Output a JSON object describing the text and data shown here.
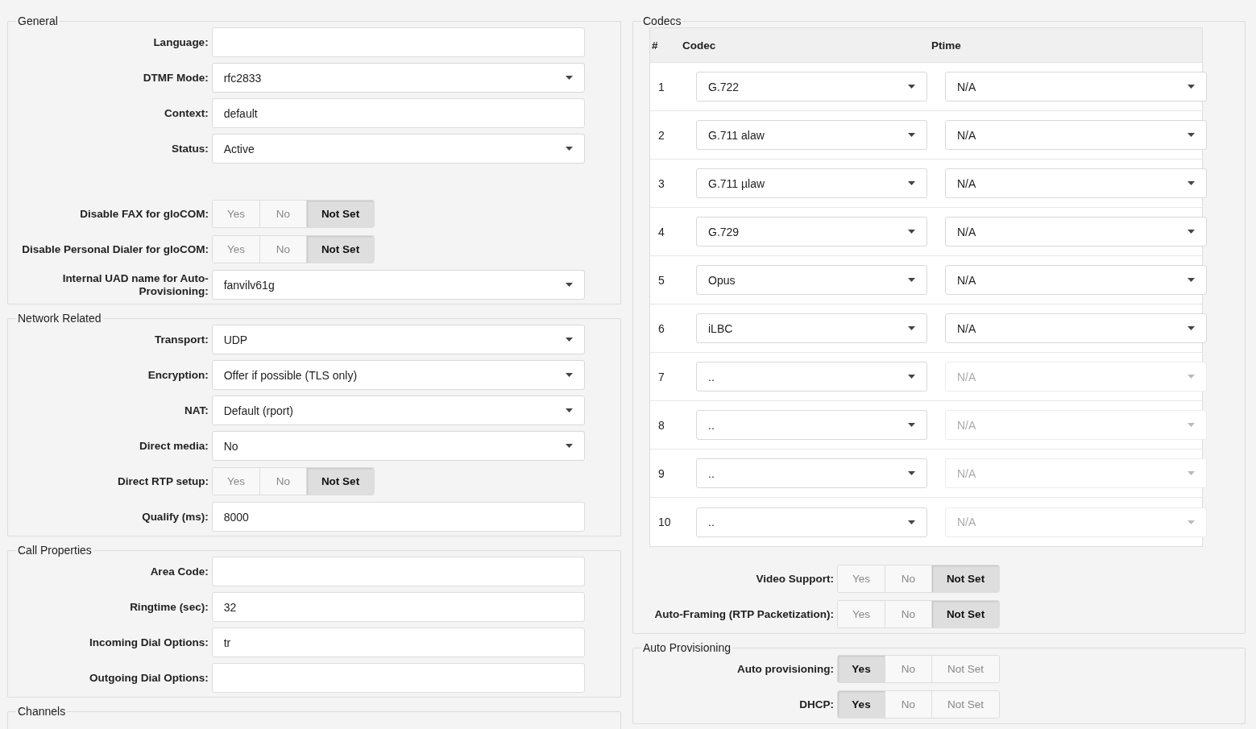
{
  "left": [
    {
      "legend": "General",
      "fields": [
        {
          "kind": "text",
          "label": "Language:"
        },
        {
          "kind": "select",
          "label": "DTMF Mode:",
          "value": "rfc2833"
        },
        {
          "kind": "text",
          "label": "Context:",
          "value": "default"
        },
        {
          "kind": "select",
          "label": "Status:",
          "value": "Active"
        },
        {
          "kind": "spacer"
        },
        {
          "kind": "toggle",
          "label": "Disable FAX for gloCOM:",
          "options": [
            {
              "label": "Yes",
              "selected": false
            },
            {
              "label": "No",
              "selected": false
            },
            {
              "label": "Not Set",
              "selected": true
            }
          ]
        },
        {
          "kind": "toggle",
          "label": "Disable Personal Dialer for gloCOM:",
          "options": [
            {
              "label": "Yes",
              "selected": false
            },
            {
              "label": "No",
              "selected": false
            },
            {
              "label": "Not Set",
              "selected": true
            }
          ]
        },
        {
          "kind": "select",
          "label": "Internal UAD name for Auto-Provisioning:",
          "value": "fanvilv61g"
        }
      ]
    },
    {
      "legend": "Network Related",
      "fields": [
        {
          "kind": "select",
          "label": "Transport:",
          "value": "UDP"
        },
        {
          "kind": "select",
          "label": "Encryption:",
          "value": "Offer if possible (TLS only)"
        },
        {
          "kind": "select",
          "label": "NAT:",
          "value": "Default (rport)"
        },
        {
          "kind": "select",
          "label": "Direct media:",
          "value": "No"
        },
        {
          "kind": "toggle",
          "label": "Direct RTP setup:",
          "options": [
            {
              "label": "Yes",
              "selected": false
            },
            {
              "label": "No",
              "selected": false
            },
            {
              "label": "Not Set",
              "selected": true
            }
          ]
        },
        {
          "kind": "text",
          "label": "Qualify (ms):",
          "value": "8000"
        }
      ]
    },
    {
      "legend": "Call Properties",
      "fields": [
        {
          "kind": "text",
          "label": "Area Code:"
        },
        {
          "kind": "text",
          "label": "Ringtime (sec):",
          "value": "32"
        },
        {
          "kind": "text",
          "label": "Incoming Dial Options:",
          "value": "tr"
        },
        {
          "kind": "text",
          "label": "Outgoing Dial Options:"
        }
      ]
    },
    {
      "legend": "Channels"
    }
  ],
  "codecs": {
    "legend": "Codecs",
    "columns": [
      "#",
      "Codec",
      "Ptime"
    ],
    "rows": [
      {
        "index": "1",
        "codec": "G.722",
        "ptime": "N/A",
        "ptime_disabled": false
      },
      {
        "index": "2",
        "codec": "G.711 alaw",
        "ptime": "N/A",
        "ptime_disabled": false
      },
      {
        "index": "3",
        "codec": "G.711 µlaw",
        "ptime": "N/A",
        "ptime_disabled": false
      },
      {
        "index": "4",
        "codec": "G.729",
        "ptime": "N/A",
        "ptime_disabled": false
      },
      {
        "index": "5",
        "codec": "Opus",
        "ptime": "N/A",
        "ptime_disabled": false
      },
      {
        "index": "6",
        "codec": "iLBC",
        "ptime": "N/A",
        "ptime_disabled": false
      },
      {
        "index": "7",
        "codec": "..",
        "ptime": "N/A",
        "ptime_disabled": true
      },
      {
        "index": "8",
        "codec": "..",
        "ptime": "N/A",
        "ptime_disabled": true
      },
      {
        "index": "9",
        "codec": "..",
        "ptime": "N/A",
        "ptime_disabled": true
      },
      {
        "index": "10",
        "codec": "..",
        "ptime": "N/A",
        "ptime_disabled": true
      }
    ],
    "fields": [
      {
        "kind": "toggle",
        "label": "Video Support:",
        "options": [
          {
            "label": "Yes",
            "selected": false
          },
          {
            "label": "No",
            "selected": false
          },
          {
            "label": "Not Set",
            "selected": true
          }
        ]
      },
      {
        "kind": "toggle",
        "label": "Auto-Framing (RTP Packetization):",
        "options": [
          {
            "label": "Yes",
            "selected": false
          },
          {
            "label": "No",
            "selected": false
          },
          {
            "label": "Not Set",
            "selected": true
          }
        ]
      }
    ]
  },
  "auto_provisioning": {
    "legend": "Auto Provisioning",
    "fields": [
      {
        "kind": "toggle",
        "label": "Auto provisioning:",
        "options": [
          {
            "label": "Yes",
            "selected": true
          },
          {
            "label": "No",
            "selected": false
          },
          {
            "label": "Not Set",
            "selected": false
          }
        ]
      },
      {
        "kind": "toggle",
        "label": "DHCP:",
        "options": [
          {
            "label": "Yes",
            "selected": true
          },
          {
            "label": "No",
            "selected": false
          },
          {
            "label": "Not Set",
            "selected": false
          }
        ]
      }
    ]
  }
}
